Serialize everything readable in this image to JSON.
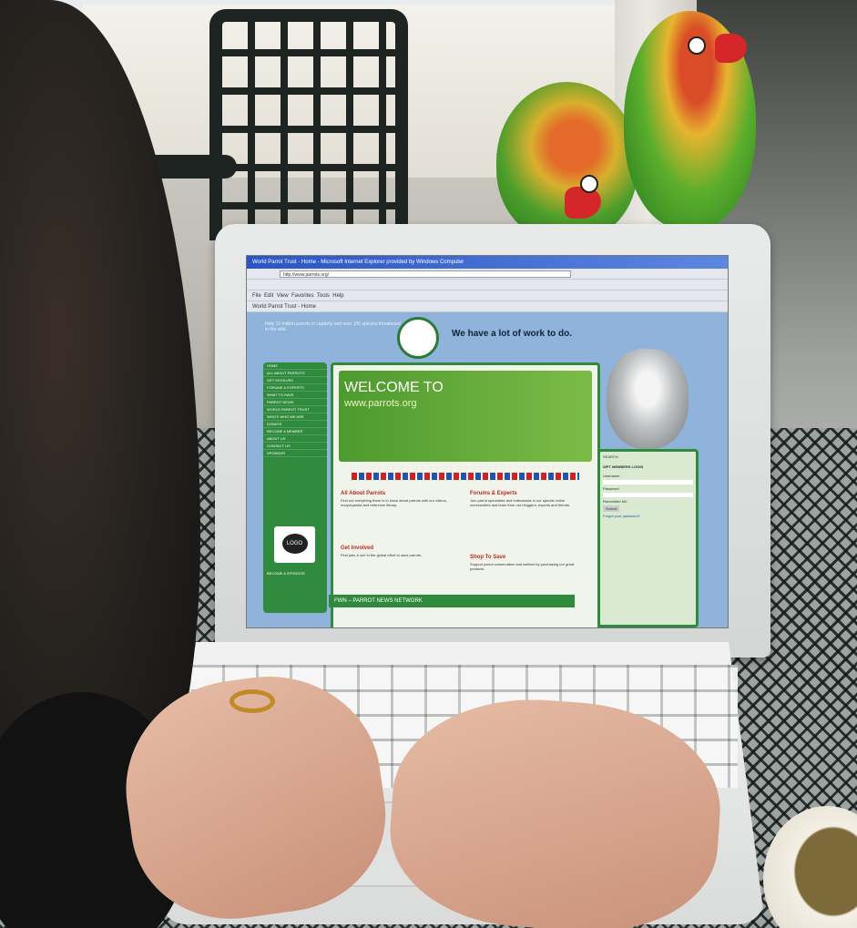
{
  "browser": {
    "title": "World Parrot Trust - Home - Microsoft Internet Explorer provided by Windows Computer",
    "address": "http://www.parrots.org/",
    "tab_label": "World Parrot Trust - Home",
    "menu": [
      "File",
      "Edit",
      "View",
      "Favorites",
      "Tools",
      "Help"
    ]
  },
  "site": {
    "header_note": "Help 10 million parrots in captivity and over 100 species threatened in the wild.",
    "tagline": "We have a lot of work to do.",
    "welcome_title": "WELCOME TO",
    "welcome_url": "www.parrots.org",
    "left_nav": [
      "HOME",
      "ALL ABOUT PARROTS",
      "GET INVOLVED",
      "FORUMS & EXPERTS",
      "WHAT TO SAVE",
      "PARROT NEWS",
      "WORLD PARROT TRUST",
      "WHO'S WHO WE ARE",
      "DONATE",
      "BECOME A MEMBER",
      "ABOUT US",
      "CONTACT US"
    ],
    "sponsor_label": "SPONSOR",
    "ad_text": "LOGO",
    "ad_caption": "BECOME A SPONSOR",
    "blocks": [
      {
        "title": "All About Parrots",
        "text": "Find out everything there is to know about parrots with our videos, encyclopedia and reference library."
      },
      {
        "title": "Forums & Experts",
        "text": "Join parrot specialists and enthusiasts in our special online communities and learn from our bloggers, experts and friends."
      },
      {
        "title": "Get Involved",
        "text": "Find jobs & see in the global effort to save parrots."
      },
      {
        "title": "Shop To Save",
        "text": "Support parrot conservation and welfare by purchasing our great products."
      }
    ],
    "news_bar": "FWN – PARROT NEWS NETWORK",
    "search_label": "SEARCH",
    "login_title": "WPT MEMBERS LOGIN",
    "username_label": "Username",
    "password_label": "Password",
    "remember_label": "Remember Me",
    "submit_label": "Submit",
    "forgot_label": "Forgot your password?"
  }
}
